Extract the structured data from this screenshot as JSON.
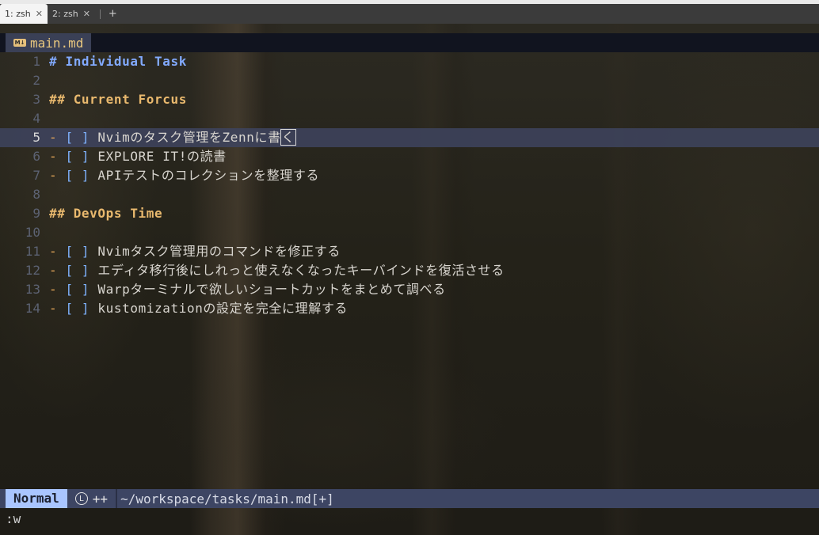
{
  "terminal": {
    "tabs": [
      {
        "label": "1: zsh",
        "active": true
      },
      {
        "label": "2: zsh",
        "active": false
      }
    ],
    "close_glyph": "✕",
    "add_glyph": "+"
  },
  "buffer": {
    "icon_text": "M↓",
    "filename": "main.md"
  },
  "lines": [
    {
      "num": "1",
      "h": "# Individual Task"
    },
    {
      "num": "2"
    },
    {
      "num": "3",
      "h2": "## Current Forcus"
    },
    {
      "num": "4"
    },
    {
      "num": "5",
      "dash": "-",
      "box": "[ ]",
      "text": "Nvimのタスク管理をZennに書",
      "cursor": "く"
    },
    {
      "num": "6",
      "dash": "-",
      "box": "[ ]",
      "text": "EXPLORE IT!の読書"
    },
    {
      "num": "7",
      "dash": "-",
      "box": "[ ]",
      "text": "APIテストのコレクションを整理する"
    },
    {
      "num": "8"
    },
    {
      "num": "9",
      "h2": "## DevOps Time"
    },
    {
      "num": "10"
    },
    {
      "num": "11",
      "dash": "-",
      "box": "[ ]",
      "text": "Nvimタスク管理用のコマンドを修正する"
    },
    {
      "num": "12",
      "dash": "-",
      "box": "[ ]",
      "text": "エディタ移行後にしれっと使えなくなったキーバインドを復活させる"
    },
    {
      "num": "13",
      "dash": "-",
      "box": "[ ]",
      "text": "Warpターミナルで欲しいショートカットをまとめて調べる"
    },
    {
      "num": "14",
      "dash": "-",
      "box": "[ ]",
      "text": "kustomizationの設定を完全に理解する"
    }
  ],
  "statusline": {
    "mode": "Normal",
    "lsp_icon": "L",
    "lsp_text": "++",
    "path": "~/workspace/tasks/main.md[+]"
  },
  "cmdline": ":w",
  "colors": {
    "heading1": "#82aaff",
    "heading2": "#e9b96e",
    "mode_bg": "#a9c5ff",
    "statusline_bg": "#3d4563"
  }
}
